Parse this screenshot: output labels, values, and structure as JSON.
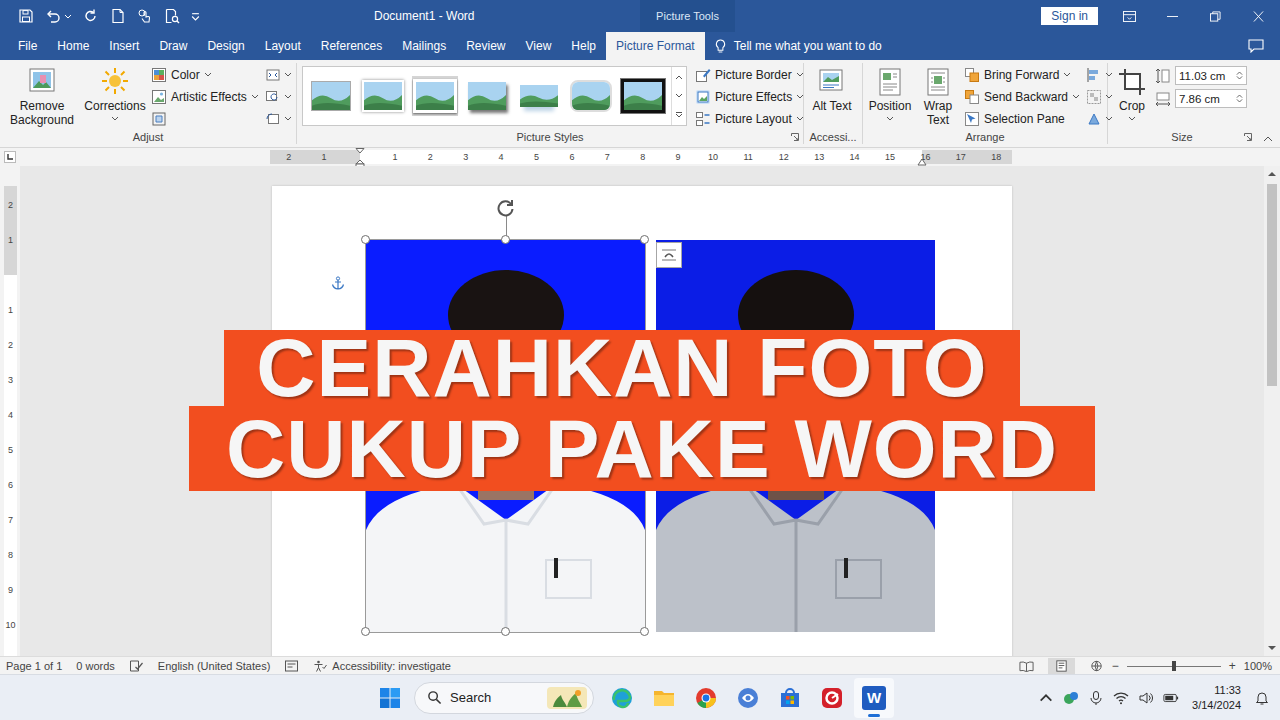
{
  "window": {
    "title": "Document1 - Word",
    "context": "Picture Tools",
    "sign_in": "Sign in"
  },
  "tabs": [
    {
      "label": "File",
      "selected": false
    },
    {
      "label": "Home",
      "selected": false
    },
    {
      "label": "Insert",
      "selected": false
    },
    {
      "label": "Draw",
      "selected": false
    },
    {
      "label": "Design",
      "selected": false
    },
    {
      "label": "Layout",
      "selected": false
    },
    {
      "label": "References",
      "selected": false
    },
    {
      "label": "Mailings",
      "selected": false
    },
    {
      "label": "Review",
      "selected": false
    },
    {
      "label": "View",
      "selected": false
    },
    {
      "label": "Help",
      "selected": false
    },
    {
      "label": "Picture Format",
      "selected": true
    }
  ],
  "tell_me": "Tell me what you want to do",
  "adjust": {
    "label": "Adjust",
    "remove_background": "Remove Background",
    "corrections": "Corrections",
    "color": "Color",
    "artistic_effects": "Artistic Effects"
  },
  "picture_styles": {
    "label": "Picture Styles",
    "styles": [
      {
        "kind": "plain"
      },
      {
        "kind": "soft"
      },
      {
        "kind": "frame"
      },
      {
        "kind": "shadow"
      },
      {
        "kind": "reflected"
      },
      {
        "kind": "rounded"
      },
      {
        "kind": "black"
      }
    ],
    "picture_border": "Picture Border",
    "picture_effects": "Picture Effects",
    "picture_layout": "Picture Layout"
  },
  "accessibility": {
    "label": "Accessi...",
    "alt_text": "Alt Text"
  },
  "arrange": {
    "label": "Arrange",
    "position": "Position",
    "wrap_text": "Wrap Text",
    "bring_forward": "Bring Forward",
    "send_backward": "Send Backward",
    "selection_pane": "Selection Pane"
  },
  "size": {
    "label": "Size",
    "crop": "Crop",
    "height": "11.03 cm",
    "width": "7.86 cm"
  },
  "ruler": {
    "horizontal_left": [
      "2",
      "1"
    ],
    "horizontal_right": [
      "1",
      "2",
      "3",
      "4",
      "5",
      "6",
      "7",
      "8",
      "9",
      "10",
      "11",
      "12",
      "13",
      "14",
      "15",
      "16",
      "17",
      "18"
    ],
    "vertical_top": [
      "2",
      "1"
    ],
    "vertical_bottom": [
      "1",
      "2",
      "3",
      "4",
      "5",
      "6",
      "7",
      "8",
      "9",
      "10"
    ]
  },
  "document": {
    "images": [
      {
        "kind": "bright",
        "selected": true
      },
      {
        "kind": "original",
        "selected": false
      }
    ],
    "banner": [
      "CERAHKAN FOTO",
      "CUKUP PAKE WORD"
    ]
  },
  "scrollbar": {
    "level": 0.44
  },
  "status_bar": {
    "page": "Page 1 of 1",
    "words": "0 words",
    "language": "English (United States)",
    "accessibility": "Accessibility: investigate",
    "zoom_out": "−",
    "zoom_in": "+",
    "zoom": "100%",
    "zoom_level": 0.5
  },
  "taskbar": {
    "search": "Search",
    "time": "11:33",
    "date": "3/14/2024",
    "apps": [
      {
        "kind": "edge",
        "active": false
      },
      {
        "kind": "explorer",
        "active": false
      },
      {
        "kind": "chrome",
        "active": false
      },
      {
        "kind": "app",
        "active": false
      },
      {
        "kind": "store",
        "active": false
      },
      {
        "kind": "red",
        "active": false
      },
      {
        "kind": "word",
        "active": true,
        "glyph": "W"
      }
    ]
  }
}
